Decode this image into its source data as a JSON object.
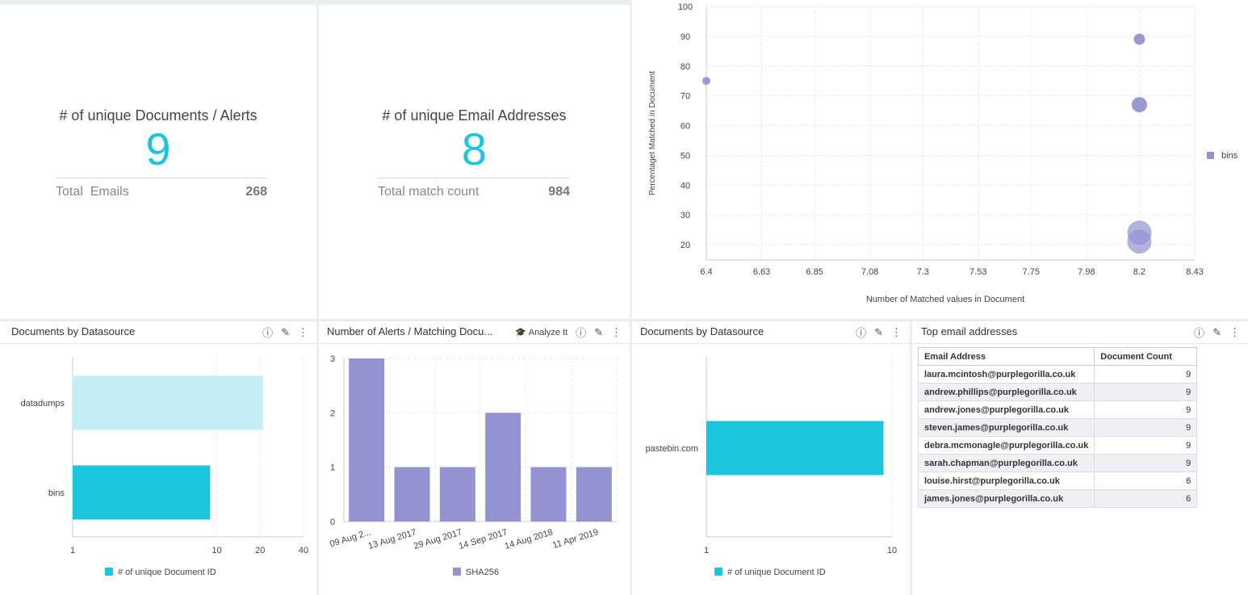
{
  "kpi1": {
    "title": "# of unique Documents / Alerts",
    "value": "9",
    "sub_label": "Total  Emails",
    "sub_value": "268"
  },
  "kpi2": {
    "title": "# of unique Email Addresses",
    "value": "8",
    "sub_label": "Total match count",
    "sub_value": "984"
  },
  "scatter": {
    "chart_data": {
      "type": "scatter",
      "xlabel": "Number of Matched values in Document",
      "ylabel": "Percentaget Matched in Document",
      "xticks": [
        "6.4",
        "6.63",
        "6.85",
        "7.08",
        "7.3",
        "7.53",
        "7.75",
        "7.98",
        "8.2",
        "8.43"
      ],
      "yticks": [
        "20",
        "30",
        "40",
        "50",
        "60",
        "70",
        "80",
        "90",
        "100"
      ],
      "xlim": [
        6.4,
        8.43
      ],
      "ylim": [
        20,
        100
      ],
      "series": [
        {
          "name": "bins",
          "color": "#9393d1",
          "points": [
            {
              "x": 6.4,
              "y": 75,
              "size": 1
            },
            {
              "x": 8.2,
              "y": 89,
              "size": 1.4
            },
            {
              "x": 8.2,
              "y": 67,
              "size": 1.9
            },
            {
              "x": 8.2,
              "y": 24,
              "size": 3
            },
            {
              "x": 8.2,
              "y": 21,
              "size": 3
            }
          ]
        }
      ],
      "legend": "right"
    }
  },
  "panel_ds1": {
    "title": "Documents by Datasource",
    "chart_data": {
      "type": "bar",
      "orientation": "horizontal",
      "scale": "log",
      "categories": [
        "datadumps",
        "bins"
      ],
      "values": [
        21,
        9
      ],
      "colors": [
        "#c3eef5",
        "#1ac6de"
      ],
      "xticks": [
        "1",
        "10",
        "20",
        "40"
      ],
      "xlim": [
        1,
        40
      ],
      "legend": "# of unique Document ID"
    }
  },
  "panel_alerts": {
    "title": "Number of Alerts / Matching Docu...",
    "analyze_label": "Analyze It",
    "chart_data": {
      "type": "bar",
      "categories": [
        "09 Aug 2...",
        "13 Aug 2017",
        "29 Aug 2017",
        "14 Sep 2017",
        "14 Aug 2018",
        "11 Apr 2019"
      ],
      "values": [
        3,
        1,
        1,
        2,
        1,
        1
      ],
      "color": "#9393d1",
      "yticks": [
        "0",
        "1",
        "2",
        "3"
      ],
      "ylim": [
        0,
        3
      ],
      "legend": "SHA256"
    }
  },
  "panel_ds2": {
    "title": "Documents by Datasource",
    "chart_data": {
      "type": "bar",
      "orientation": "horizontal",
      "scale": "log",
      "categories": [
        "pastebin.com"
      ],
      "values": [
        9
      ],
      "color": "#1ac6de",
      "xticks": [
        "1",
        "10"
      ],
      "xlim": [
        1,
        10
      ],
      "legend": "# of unique Document ID"
    }
  },
  "panel_top": {
    "title": "Top email addresses",
    "columns": [
      "Email Address",
      "Document Count"
    ],
    "rows": [
      [
        "laura.mcintosh@purplegorilla.co.uk",
        "9"
      ],
      [
        "andrew.phillips@purplegorilla.co.uk",
        "9"
      ],
      [
        "andrew.jones@purplegorilla.co.uk",
        "9"
      ],
      [
        "steven.james@purplegorilla.co.uk",
        "9"
      ],
      [
        "debra.mcmonagle@purplegorilla.co.uk",
        "9"
      ],
      [
        "sarah.chapman@purplegorilla.co.uk",
        "9"
      ],
      [
        "louise.hirst@purplegorilla.co.uk",
        "6"
      ],
      [
        "james.jones@purplegorilla.co.uk",
        "6"
      ]
    ]
  },
  "icons": {
    "info": "ⓘ",
    "edit": "✎",
    "more": "⋮",
    "analyze": "🎓"
  }
}
